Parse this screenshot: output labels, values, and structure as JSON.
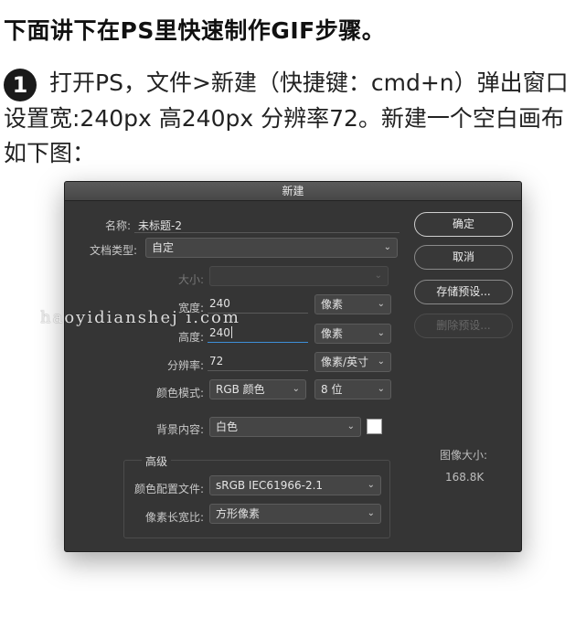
{
  "heading": "下面讲下在PS里快速制作GIF步骤。",
  "instruction": {
    "step_number": "1",
    "text": "打开PS，文件>新建（快捷键：cmd+n）弹出窗口设置宽:240px 高240px  分辨率72。新建一个空白画布如下图："
  },
  "dialog": {
    "title": "新建",
    "name_label": "名称:",
    "name_value": "未标题-2",
    "doc_type_label": "文档类型:",
    "doc_type_value": "自定",
    "size_label": "大小:",
    "size_value": "",
    "width_label": "宽度:",
    "width_value": "240",
    "width_unit": "像素",
    "height_label": "高度:",
    "height_value": "240",
    "height_unit": "像素",
    "resolution_label": "分辨率:",
    "resolution_value": "72",
    "resolution_unit": "像素/英寸",
    "color_mode_label": "颜色模式:",
    "color_mode_value": "RGB 颜色",
    "bit_depth_value": "8 位",
    "bg_label": "背景内容:",
    "bg_value": "白色",
    "bg_swatch_color": "#ffffff",
    "advanced_title": "高级",
    "color_profile_label": "颜色配置文件:",
    "color_profile_value": "sRGB IEC61966-2.1",
    "pixel_aspect_label": "像素长宽比:",
    "pixel_aspect_value": "方形像素",
    "image_size_label": "图像大小:",
    "image_size_value": "168.8K",
    "buttons": {
      "ok": "确定",
      "cancel": "取消",
      "save_preset": "存储预设...",
      "delete_preset": "删除预设..."
    }
  },
  "watermark": "haoyidianshej i.com"
}
